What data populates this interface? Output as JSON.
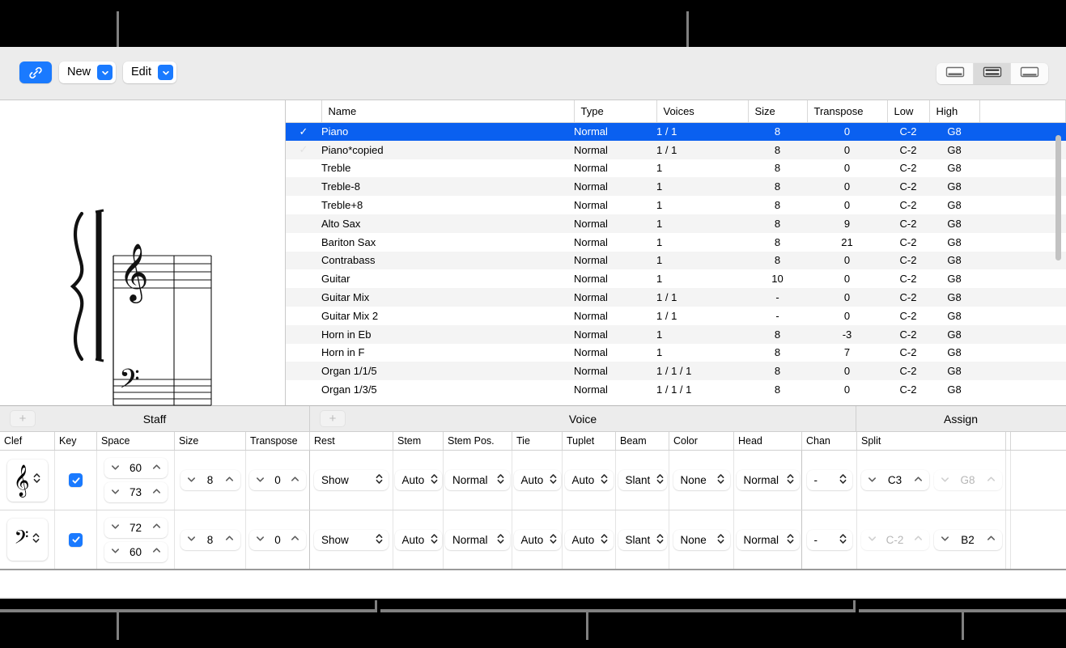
{
  "toolbar": {
    "link_icon": "link-icon",
    "new_label": "New",
    "edit_label": "Edit",
    "view_buttons": [
      "single-pane-icon",
      "split-pane-icon",
      "bottom-pane-icon"
    ]
  },
  "preview": {
    "description": "grand-staff-preview",
    "brace": "brace-glyph",
    "treble_clef": "treble-clef-glyph",
    "bass_clef": "bass-clef-glyph"
  },
  "table": {
    "columns": [
      "Name",
      "Type",
      "Voices",
      "Size",
      "Transpose",
      "Low",
      "High"
    ],
    "check_glyph": "✓",
    "rows": [
      {
        "check": "✓",
        "name": "Piano",
        "type": "Normal",
        "voices": "1 / 1",
        "size": "8",
        "transpose": "0",
        "low": "C-2",
        "high": "G8",
        "selected": true,
        "dim_check": false,
        "dim_size": false
      },
      {
        "check": "✓",
        "name": "Piano*copied",
        "type": "Normal",
        "voices": "1 / 1",
        "size": "8",
        "transpose": "0",
        "low": "C-2",
        "high": "G8",
        "selected": false,
        "dim_check": true,
        "dim_size": false
      },
      {
        "check": "",
        "name": "Treble",
        "type": "Normal",
        "voices": "1",
        "size": "8",
        "transpose": "0",
        "low": "C-2",
        "high": "G8",
        "selected": false,
        "dim_check": false,
        "dim_size": false
      },
      {
        "check": "",
        "name": "Treble-8",
        "type": "Normal",
        "voices": "1",
        "size": "8",
        "transpose": "0",
        "low": "C-2",
        "high": "G8",
        "selected": false,
        "dim_check": false,
        "dim_size": false
      },
      {
        "check": "",
        "name": "Treble+8",
        "type": "Normal",
        "voices": "1",
        "size": "8",
        "transpose": "0",
        "low": "C-2",
        "high": "G8",
        "selected": false,
        "dim_check": false,
        "dim_size": false
      },
      {
        "check": "",
        "name": "Alto Sax",
        "type": "Normal",
        "voices": "1",
        "size": "8",
        "transpose": "9",
        "low": "C-2",
        "high": "G8",
        "selected": false,
        "dim_check": false,
        "dim_size": false
      },
      {
        "check": "",
        "name": "Bariton Sax",
        "type": "Normal",
        "voices": "1",
        "size": "8",
        "transpose": "21",
        "low": "C-2",
        "high": "G8",
        "selected": false,
        "dim_check": false,
        "dim_size": false
      },
      {
        "check": "",
        "name": "Contrabass",
        "type": "Normal",
        "voices": "1",
        "size": "8",
        "transpose": "0",
        "low": "C-2",
        "high": "G8",
        "selected": false,
        "dim_check": false,
        "dim_size": false
      },
      {
        "check": "",
        "name": "Guitar",
        "type": "Normal",
        "voices": "1",
        "size": "10",
        "transpose": "0",
        "low": "C-2",
        "high": "G8",
        "selected": false,
        "dim_check": false,
        "dim_size": false
      },
      {
        "check": "",
        "name": "Guitar Mix",
        "type": "Normal",
        "voices": "1 / 1",
        "size": "-",
        "transpose": "0",
        "low": "C-2",
        "high": "G8",
        "selected": false,
        "dim_check": false,
        "dim_size": true
      },
      {
        "check": "",
        "name": "Guitar Mix 2",
        "type": "Normal",
        "voices": "1 / 1",
        "size": "-",
        "transpose": "0",
        "low": "C-2",
        "high": "G8",
        "selected": false,
        "dim_check": false,
        "dim_size": true
      },
      {
        "check": "",
        "name": "Horn in Eb",
        "type": "Normal",
        "voices": "1",
        "size": "8",
        "transpose": "-3",
        "low": "C-2",
        "high": "G8",
        "selected": false,
        "dim_check": false,
        "dim_size": false
      },
      {
        "check": "",
        "name": "Horn in F",
        "type": "Normal",
        "voices": "1",
        "size": "8",
        "transpose": "7",
        "low": "C-2",
        "high": "G8",
        "selected": false,
        "dim_check": false,
        "dim_size": false
      },
      {
        "check": "",
        "name": "Organ 1/1/5",
        "type": "Normal",
        "voices": "1 / 1 / 1",
        "size": "8",
        "transpose": "0",
        "low": "C-2",
        "high": "G8",
        "selected": false,
        "dim_check": false,
        "dim_size": false
      },
      {
        "check": "",
        "name": "Organ 1/3/5",
        "type": "Normal",
        "voices": "1 / 1 / 1",
        "size": "8",
        "transpose": "0",
        "low": "C-2",
        "high": "G8",
        "selected": false,
        "dim_check": false,
        "dim_size": false
      }
    ]
  },
  "params": {
    "groups": {
      "staff": "Staff",
      "voice": "Voice",
      "assign": "Assign"
    },
    "add_glyph": "+",
    "columns": {
      "clef": "Clef",
      "key": "Key",
      "space": "Space",
      "size": "Size",
      "transpose": "Transpose",
      "rest": "Rest",
      "stem": "Stem",
      "stem_pos": "Stem Pos.",
      "tie": "Tie",
      "tuplet": "Tuplet",
      "beam": "Beam",
      "color": "Color",
      "head": "Head",
      "chan": "Chan",
      "split": "Split"
    },
    "rows": [
      {
        "clef": "𝄞",
        "clef_name": "treble-clef",
        "key_checked": true,
        "space_top": "60",
        "space_bottom": "73",
        "size": "8",
        "transpose": "0",
        "rest": "Show",
        "stem": "Auto",
        "stem_pos": "Normal",
        "tie": "Auto",
        "tuplet": "Auto",
        "beam": "Slant",
        "color": "None",
        "head": "Normal",
        "chan": "-",
        "split_low": "C3",
        "split_high": "G8",
        "split_low_dim": false,
        "split_high_dim": true
      },
      {
        "clef": "𝄢",
        "clef_name": "bass-clef",
        "key_checked": true,
        "space_top": "72",
        "space_bottom": "60",
        "size": "8",
        "transpose": "0",
        "rest": "Show",
        "stem": "Auto",
        "stem_pos": "Normal",
        "tie": "Auto",
        "tuplet": "Auto",
        "beam": "Slant",
        "color": "None",
        "head": "Normal",
        "chan": "-",
        "split_low": "C-2",
        "split_high": "B2",
        "split_low_dim": true,
        "split_high_dim": false
      }
    ]
  },
  "colors": {
    "accent": "#1a7aff",
    "selection": "#0a60f0",
    "window_chrome": "#ececec",
    "row_alt": "#f4f4f4",
    "annotation": "#808080"
  }
}
